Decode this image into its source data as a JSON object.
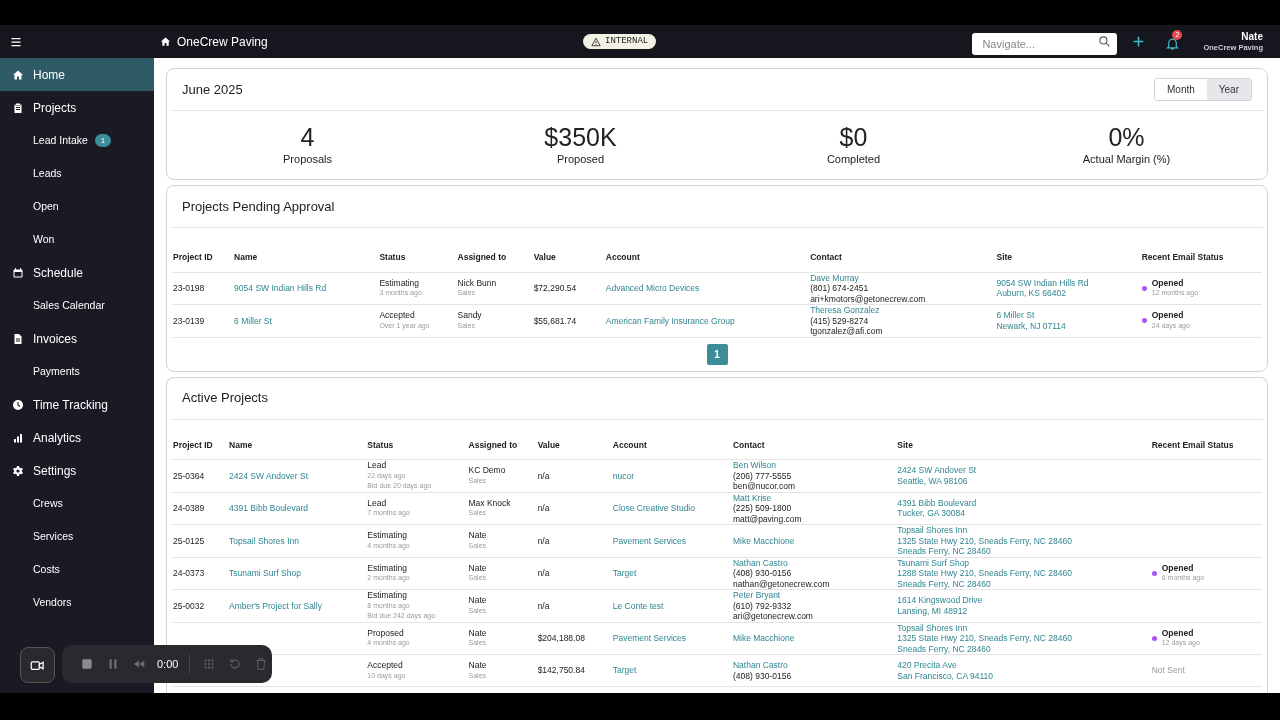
{
  "header": {
    "company": "OneCrew Paving",
    "environment_badge": "INTERNAL",
    "search": {
      "placeholder": "Navigate..."
    },
    "notifications_count": "2",
    "user": {
      "name": "Nate",
      "company": "OneCrew Paving"
    }
  },
  "sidebar": {
    "items": [
      {
        "label": "Home",
        "selected": true
      },
      {
        "label": "Projects",
        "selected": false,
        "children": [
          {
            "label": "Lead Intake",
            "badge": "1",
            "selected": false
          },
          {
            "label": "Leads",
            "selected": false
          },
          {
            "label": "Open",
            "selected": false
          },
          {
            "label": "Won",
            "selected": false
          }
        ]
      },
      {
        "label": "Schedule",
        "selected": false,
        "children": [
          {
            "label": "Sales Calendar",
            "selected": false
          }
        ]
      },
      {
        "label": "Invoices",
        "selected": false,
        "children": [
          {
            "label": "Payments",
            "selected": false
          }
        ]
      },
      {
        "label": "Time Tracking",
        "selected": false
      },
      {
        "label": "Analytics",
        "selected": false
      },
      {
        "label": "Settings",
        "selected": false,
        "children": [
          {
            "label": "Crews",
            "selected": false
          },
          {
            "label": "Services",
            "selected": false
          },
          {
            "label": "Costs",
            "selected": false
          },
          {
            "label": "Vendors",
            "selected": false
          }
        ]
      }
    ]
  },
  "summary": {
    "title": "June 2025",
    "periods": [
      {
        "label": "Month",
        "selected": false
      },
      {
        "label": "Year",
        "selected": true
      }
    ],
    "stats": [
      {
        "value": "4",
        "label": "Proposals"
      },
      {
        "value": "$350K",
        "label": "Proposed"
      },
      {
        "value": "$0",
        "label": "Completed"
      },
      {
        "value": "0%",
        "label": "Actual Margin (%)"
      }
    ]
  },
  "tables": [
    {
      "title": "Projects Pending Approval",
      "columns": [
        "Project ID",
        "Name",
        "Status",
        "Assigned to",
        "Value",
        "Account",
        "Contact",
        "Site",
        "Recent Email Status"
      ],
      "rows": [
        {
          "id": "23-0198",
          "name": "9054 SW Indian Hills Rd",
          "status": "Estimating",
          "status_time": "3 months ago",
          "assignee": "Nick Bunn",
          "role": "Sales",
          "value": "$72,290.54",
          "account": "Advanced Micro Devices",
          "contact": {
            "name": "Dave Murray",
            "phone": "(801) 674-2451",
            "email": "ari+kmotors@getonecrew.com"
          },
          "site": [
            "9054 SW Indian Hills Rd",
            "Auburn, KS 66402"
          ],
          "email_status": {
            "kind": "opened",
            "label": "Opened",
            "time": "12 months ago"
          }
        },
        {
          "id": "23-0139",
          "name": "6 Miller St",
          "status": "Accepted",
          "status_time": "Over 1 year ago",
          "assignee": "Sandy",
          "role": "Sales",
          "value": "$55,681.74",
          "account": "American Family Insurance Group",
          "contact": {
            "name": "Theresa Gonzalez",
            "phone": "(415) 529-8274",
            "email": "tgonzalez@afi.com"
          },
          "site": [
            "6 Miller St",
            "Newark, NJ 07114"
          ],
          "email_status": {
            "kind": "opened",
            "label": "Opened",
            "time": "24 days ago"
          }
        }
      ],
      "pages": [
        {
          "label": "1",
          "selected": true
        }
      ]
    },
    {
      "title": "Active Projects",
      "columns": [
        "Project ID",
        "Name",
        "Status",
        "Assigned to",
        "Value",
        "Account",
        "Contact",
        "Site",
        "Recent Email Status"
      ],
      "rows": [
        {
          "id": "25-0364",
          "name": "2424 SW Andover St",
          "status": "Lead",
          "status_time": "22 days ago",
          "bid_due": "Bid due 20 days ago",
          "assignee": "KC Demo",
          "role": "Sales",
          "value": "n/a",
          "account": "nucor",
          "contact": {
            "name": "Ben Wilson",
            "phone": "(206) 777-5555",
            "email": "ben@nucor.com"
          },
          "site": [
            "2424 SW Andover St",
            "Seattle, WA 98106"
          ]
        },
        {
          "id": "24-0389",
          "name": "4391 Bibb Boulevard",
          "status": "Lead",
          "status_time": "7 months ago",
          "assignee": "Max Knock",
          "role": "Sales",
          "value": "n/a",
          "account": "Close Creative Studio",
          "contact": {
            "name": "Matt Krise",
            "phone": "(225) 509-1800",
            "email": "matt@paving.com"
          },
          "site": [
            "4391 Bibb Boulevard",
            "Tucker, GA 30084"
          ]
        },
        {
          "id": "25-0125",
          "name": "Topsail Shores Inn",
          "status": "Estimating",
          "status_time": "4 months ago",
          "assignee": "Nate",
          "role": "Sales",
          "value": "n/a",
          "account": "Pavement Services",
          "contact": {
            "name": "Mike Macchione"
          },
          "site": [
            "Topsail Shores Inn",
            "1325 State Hwy 210, Sneads Ferry, NC 28460",
            "Sneads Ferry, NC 28460"
          ]
        },
        {
          "id": "24-0373",
          "name": "Tsunami Surf Shop",
          "status": "Estimating",
          "status_time": "2 months ago",
          "assignee": "Nate",
          "role": "Sales",
          "value": "n/a",
          "account": "Target",
          "contact": {
            "name": "Nathan Castro",
            "phone": "(408) 930-0156",
            "email": "nathan@getonecrew.com"
          },
          "site": [
            "Tsunami Surf Shop",
            "1288 State Hwy 210, Sneads Ferry, NC 28460",
            "Sneads Ferry, NC 28460"
          ],
          "email_status": {
            "kind": "opened",
            "label": "Opened",
            "time": "6 months ago"
          }
        },
        {
          "id": "25-0032",
          "name": "Amber's Project for Sally",
          "status": "Estimating",
          "status_time": "8 months ago",
          "bid_due": "Bid due 242 days ago",
          "assignee": "Nate",
          "role": "Sales",
          "value": "n/a",
          "account": "Le Conte test",
          "contact": {
            "name": "Peter Bryant",
            "phone": "(610) 792-9332",
            "email": "ari@getonecrew.com"
          },
          "site": [
            "1614 Kingswood Drive",
            "Lansing, MI 48912"
          ]
        },
        {
          "status": "Proposed",
          "status_time": "4 months ago",
          "assignee": "Nate",
          "role": "Sales",
          "value": "$204,188.08",
          "account": "Pavement Services",
          "contact": {
            "name": "Mike Macchione"
          },
          "site": [
            "Topsail Shores Inn",
            "1325 State Hwy 210, Sneads Ferry, NC 28460",
            "Sneads Ferry, NC 28460"
          ],
          "email_status": {
            "kind": "opened",
            "label": "Opened",
            "time": "12 days ago"
          }
        },
        {
          "status": "Accepted",
          "status_time": "10 days ago",
          "assignee": "Nate",
          "role": "Sales",
          "value": "$142,750.84",
          "account": "Target",
          "contact": {
            "name": "Nathan Castro",
            "phone": "(408) 930-0156"
          },
          "site": [
            "420 Precita Ave",
            "San Francisco, CA 94110"
          ],
          "email_status": {
            "kind": "not_sent",
            "label": "Not Sent"
          }
        }
      ]
    }
  ],
  "recorder": {
    "timer": "0:00"
  }
}
